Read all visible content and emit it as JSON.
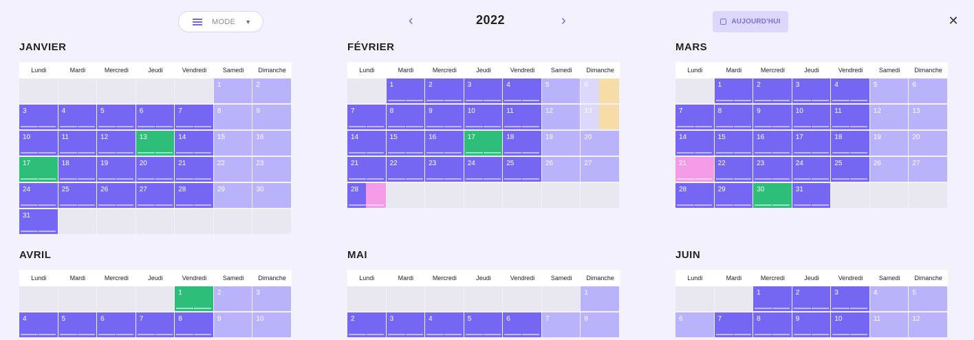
{
  "toolbar": {
    "mode_label": "MODE",
    "prev_symbol": "‹",
    "next_symbol": "›",
    "year": "2022",
    "today_label": "AUJOURD'HUI",
    "close_symbol": "✕"
  },
  "weekdays": [
    "Lundi",
    "Mardi",
    "Mercredi",
    "Jeudi",
    "Vendredi",
    "Samedi",
    "Dimanche"
  ],
  "colors": {
    "workday": "#7566f4",
    "weekend": "#b9b3fb",
    "empty": "#e9e7f0",
    "green": "#2dbf7a",
    "pink": "#f39be7",
    "orange": "#f6dca6"
  },
  "months": [
    {
      "name": "JANVIER",
      "cells": [
        {
          "t": "empty"
        },
        {
          "t": "empty"
        },
        {
          "t": "empty"
        },
        {
          "t": "empty"
        },
        {
          "t": "empty"
        },
        {
          "d": "1",
          "t": "we"
        },
        {
          "d": "2",
          "t": "we"
        },
        {
          "d": "3",
          "t": "wd",
          "lines": true
        },
        {
          "d": "4",
          "t": "wd",
          "lines": true
        },
        {
          "d": "5",
          "t": "wd",
          "lines": true
        },
        {
          "d": "6",
          "t": "wd",
          "lines": true
        },
        {
          "d": "7",
          "t": "wd",
          "lines": true
        },
        {
          "d": "8",
          "t": "we"
        },
        {
          "d": "9",
          "t": "we"
        },
        {
          "d": "10",
          "t": "wd",
          "lines": true
        },
        {
          "d": "11",
          "t": "wd",
          "lines": true
        },
        {
          "d": "12",
          "t": "wd",
          "lines": true
        },
        {
          "d": "13",
          "t": "green",
          "lines": true
        },
        {
          "d": "14",
          "t": "wd",
          "lines": true
        },
        {
          "d": "15",
          "t": "we"
        },
        {
          "d": "16",
          "t": "we"
        },
        {
          "d": "17",
          "t": "green",
          "lines": true
        },
        {
          "d": "18",
          "t": "wd",
          "lines": true
        },
        {
          "d": "19",
          "t": "wd",
          "lines": true
        },
        {
          "d": "20",
          "t": "wd",
          "lines": true
        },
        {
          "d": "21",
          "t": "wd",
          "lines": true
        },
        {
          "d": "22",
          "t": "we"
        },
        {
          "d": "23",
          "t": "we"
        },
        {
          "d": "24",
          "t": "wd",
          "lines": true
        },
        {
          "d": "25",
          "t": "wd",
          "lines": true
        },
        {
          "d": "26",
          "t": "wd",
          "lines": true
        },
        {
          "d": "27",
          "t": "wd",
          "lines": true
        },
        {
          "d": "28",
          "t": "wd",
          "lines": true
        },
        {
          "d": "29",
          "t": "we"
        },
        {
          "d": "30",
          "t": "we"
        },
        {
          "d": "31",
          "t": "wd",
          "lines": true
        },
        {
          "t": "empty"
        },
        {
          "t": "empty"
        },
        {
          "t": "empty"
        },
        {
          "t": "empty"
        },
        {
          "t": "empty"
        },
        {
          "t": "empty"
        }
      ]
    },
    {
      "name": "FÉVRIER",
      "cells": [
        {
          "t": "empty"
        },
        {
          "d": "1",
          "t": "wd",
          "lines": true
        },
        {
          "d": "2",
          "t": "wd",
          "lines": true
        },
        {
          "d": "3",
          "t": "wd",
          "lines": true
        },
        {
          "d": "4",
          "t": "wd",
          "lines": true
        },
        {
          "d": "5",
          "t": "we"
        },
        {
          "d": "6",
          "t": "we-light-orange"
        },
        {
          "d": "7",
          "t": "wd",
          "lines": true
        },
        {
          "d": "8",
          "t": "wd",
          "lines": true
        },
        {
          "d": "9",
          "t": "wd",
          "lines": true
        },
        {
          "d": "10",
          "t": "wd",
          "lines": true
        },
        {
          "d": "11",
          "t": "wd",
          "lines": true
        },
        {
          "d": "12",
          "t": "we"
        },
        {
          "d": "13",
          "t": "we-light-orange"
        },
        {
          "d": "14",
          "t": "wd",
          "lines": true
        },
        {
          "d": "15",
          "t": "wd",
          "lines": true
        },
        {
          "d": "16",
          "t": "wd",
          "lines": true
        },
        {
          "d": "17",
          "t": "green",
          "lines": true
        },
        {
          "d": "18",
          "t": "wd",
          "lines": true
        },
        {
          "d": "19",
          "t": "we"
        },
        {
          "d": "20",
          "t": "we"
        },
        {
          "d": "21",
          "t": "wd",
          "lines": true
        },
        {
          "d": "22",
          "t": "wd",
          "lines": true
        },
        {
          "d": "23",
          "t": "wd",
          "lines": true
        },
        {
          "d": "24",
          "t": "wd",
          "lines": true
        },
        {
          "d": "25",
          "t": "wd",
          "lines": true
        },
        {
          "d": "26",
          "t": "we"
        },
        {
          "d": "27",
          "t": "we"
        },
        {
          "d": "28",
          "t": "pink",
          "lines": true
        },
        {
          "t": "empty"
        },
        {
          "t": "empty"
        },
        {
          "t": "empty"
        },
        {
          "t": "empty"
        },
        {
          "t": "empty"
        },
        {
          "t": "empty"
        }
      ]
    },
    {
      "name": "MARS",
      "cells": [
        {
          "t": "empty"
        },
        {
          "d": "1",
          "t": "wd",
          "lines": true
        },
        {
          "d": "2",
          "t": "wd",
          "lines": true
        },
        {
          "d": "3",
          "t": "wd",
          "lines": true
        },
        {
          "d": "4",
          "t": "wd",
          "lines": true
        },
        {
          "d": "5",
          "t": "we"
        },
        {
          "d": "6",
          "t": "we"
        },
        {
          "d": "7",
          "t": "wd",
          "lines": true
        },
        {
          "d": "8",
          "t": "wd",
          "lines": true
        },
        {
          "d": "9",
          "t": "wd",
          "lines": true
        },
        {
          "d": "10",
          "t": "wd",
          "lines": true
        },
        {
          "d": "11",
          "t": "wd",
          "lines": true
        },
        {
          "d": "12",
          "t": "we"
        },
        {
          "d": "13",
          "t": "we"
        },
        {
          "d": "14",
          "t": "wd",
          "lines": true
        },
        {
          "d": "15",
          "t": "wd",
          "lines": true
        },
        {
          "d": "16",
          "t": "wd",
          "lines": true
        },
        {
          "d": "17",
          "t": "wd",
          "lines": true
        },
        {
          "d": "18",
          "t": "wd",
          "lines": true
        },
        {
          "d": "19",
          "t": "we"
        },
        {
          "d": "20",
          "t": "we"
        },
        {
          "d": "21",
          "t": "pinkfull",
          "lines": true
        },
        {
          "d": "22",
          "t": "wd",
          "lines": true
        },
        {
          "d": "23",
          "t": "wd",
          "lines": true
        },
        {
          "d": "24",
          "t": "wd",
          "lines": true
        },
        {
          "d": "25",
          "t": "wd",
          "lines": true
        },
        {
          "d": "26",
          "t": "we"
        },
        {
          "d": "27",
          "t": "we"
        },
        {
          "d": "28",
          "t": "wd",
          "lines": true
        },
        {
          "d": "29",
          "t": "wd",
          "lines": true
        },
        {
          "d": "30",
          "t": "green",
          "lines": true
        },
        {
          "d": "31",
          "t": "wd",
          "lines": true
        },
        {
          "t": "empty"
        },
        {
          "t": "empty"
        },
        {
          "t": "empty"
        }
      ]
    },
    {
      "name": "AVRIL",
      "cells": [
        {
          "t": "empty"
        },
        {
          "t": "empty"
        },
        {
          "t": "empty"
        },
        {
          "t": "empty"
        },
        {
          "d": "1",
          "t": "green",
          "lines": true
        },
        {
          "d": "2",
          "t": "we"
        },
        {
          "d": "3",
          "t": "we"
        },
        {
          "d": "4",
          "t": "wd",
          "lines": true
        },
        {
          "d": "5",
          "t": "wd",
          "lines": true
        },
        {
          "d": "6",
          "t": "wd",
          "lines": true
        },
        {
          "d": "7",
          "t": "wd",
          "lines": true
        },
        {
          "d": "8",
          "t": "wd",
          "lines": true
        },
        {
          "d": "9",
          "t": "we"
        },
        {
          "d": "10",
          "t": "we"
        }
      ]
    },
    {
      "name": "MAI",
      "cells": [
        {
          "t": "empty"
        },
        {
          "t": "empty"
        },
        {
          "t": "empty"
        },
        {
          "t": "empty"
        },
        {
          "t": "empty"
        },
        {
          "t": "empty"
        },
        {
          "d": "1",
          "t": "we"
        },
        {
          "d": "2",
          "t": "wd",
          "lines": true
        },
        {
          "d": "3",
          "t": "wd",
          "lines": true
        },
        {
          "d": "4",
          "t": "wd",
          "lines": true
        },
        {
          "d": "5",
          "t": "wd",
          "lines": true
        },
        {
          "d": "6",
          "t": "wd",
          "lines": true
        },
        {
          "d": "7",
          "t": "we"
        },
        {
          "d": "8",
          "t": "we"
        }
      ]
    },
    {
      "name": "JUIN",
      "cells": [
        {
          "t": "empty"
        },
        {
          "t": "empty"
        },
        {
          "d": "1",
          "t": "wd",
          "lines": true
        },
        {
          "d": "2",
          "t": "wd",
          "lines": true
        },
        {
          "d": "3",
          "t": "wd",
          "lines": true
        },
        {
          "d": "4",
          "t": "we"
        },
        {
          "d": "5",
          "t": "we"
        },
        {
          "d": "6",
          "t": "we"
        },
        {
          "d": "7",
          "t": "wd",
          "lines": true
        },
        {
          "d": "8",
          "t": "wd",
          "lines": true
        },
        {
          "d": "9",
          "t": "wd",
          "lines": true
        },
        {
          "d": "10",
          "t": "wd",
          "lines": true
        },
        {
          "d": "11",
          "t": "we"
        },
        {
          "d": "12",
          "t": "we"
        }
      ]
    }
  ]
}
